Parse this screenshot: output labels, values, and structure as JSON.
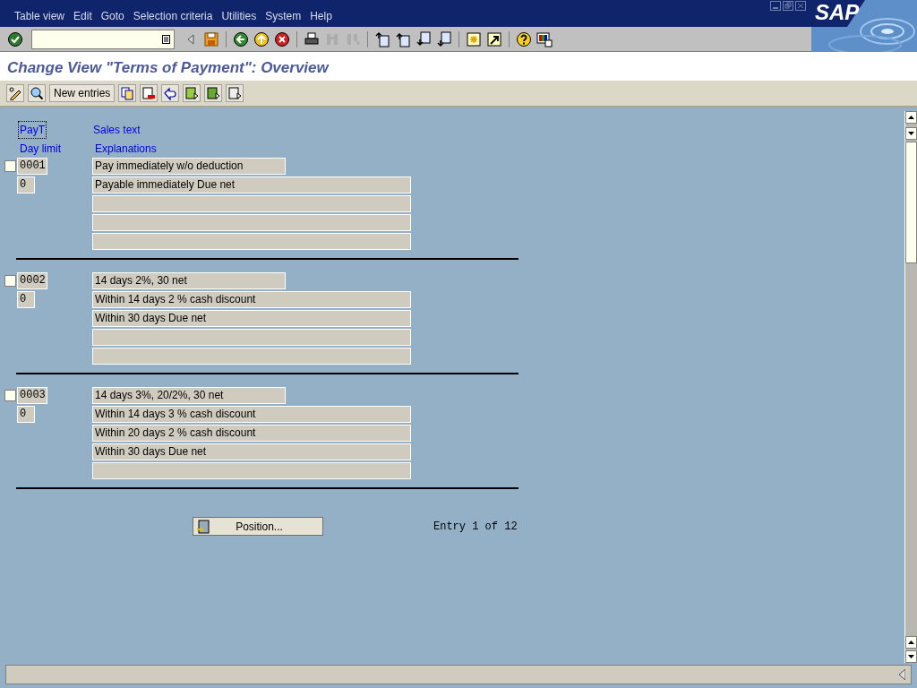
{
  "menu": [
    "Table view",
    "Edit",
    "Goto",
    "Selection criteria",
    "Utilities",
    "System",
    "Help"
  ],
  "logo": "SAP",
  "system_toolbar": [
    [
      {
        "kind": "enter",
        "disabled": false
      },
      {
        "kind": "command",
        "disabled": false
      },
      {
        "kind": "collapse",
        "disabled": false
      },
      {
        "kind": "save",
        "disabled": false
      }
    ],
    [
      {
        "kind": "back",
        "disabled": false
      },
      {
        "kind": "exit",
        "disabled": false
      },
      {
        "kind": "cancel",
        "disabled": false
      }
    ],
    [
      {
        "kind": "print",
        "disabled": false
      },
      {
        "kind": "find",
        "disabled": true
      },
      {
        "kind": "findnext",
        "disabled": true
      }
    ],
    [
      {
        "kind": "first",
        "disabled": false
      },
      {
        "kind": "prev",
        "disabled": false
      },
      {
        "kind": "next",
        "disabled": false
      },
      {
        "kind": "last",
        "disabled": false
      }
    ],
    [
      {
        "kind": "session",
        "disabled": false
      },
      {
        "kind": "shortcut",
        "disabled": false
      }
    ],
    [
      {
        "kind": "help",
        "disabled": false
      },
      {
        "kind": "layout",
        "disabled": false
      }
    ]
  ],
  "title": "Change View \"Terms of Payment\": Overview",
  "app_toolbar": [
    {
      "kind": "edit"
    },
    {
      "kind": "details"
    },
    {
      "kind": "text",
      "label": "New entries"
    },
    {
      "kind": "copy"
    },
    {
      "kind": "delete"
    },
    {
      "kind": "undo"
    },
    {
      "kind": "selectall"
    },
    {
      "kind": "selectblock"
    },
    {
      "kind": "deselect"
    }
  ],
  "headers": {
    "key": {
      "label": "PayT",
      "focused": true
    },
    "sales_text": "Sales text",
    "day_limit": "Day limit",
    "explanations": "Explanations"
  },
  "records": [
    {
      "selected": false,
      "payt": "0001",
      "day_limit": "0",
      "sales_text": "Pay immediately w/o deduction",
      "explanations": [
        "Payable immediately Due net"
      ]
    },
    {
      "selected": false,
      "payt": "0002",
      "day_limit": "0",
      "sales_text": "14 days 2%, 30 net",
      "explanations": [
        "Within 14 days 2 % cash discount",
        "Within 30 days Due net"
      ]
    },
    {
      "selected": false,
      "payt": "0003",
      "day_limit": "0",
      "sales_text": "14 days 3%, 20/2%, 30 net",
      "explanations": [
        "Within 14 days 3 % cash discount",
        "Within 20 days 2 % cash discount",
        "Within 30 days Due net"
      ]
    }
  ],
  "position_button": "Position...",
  "entry_info": "Entry 1 of 12"
}
